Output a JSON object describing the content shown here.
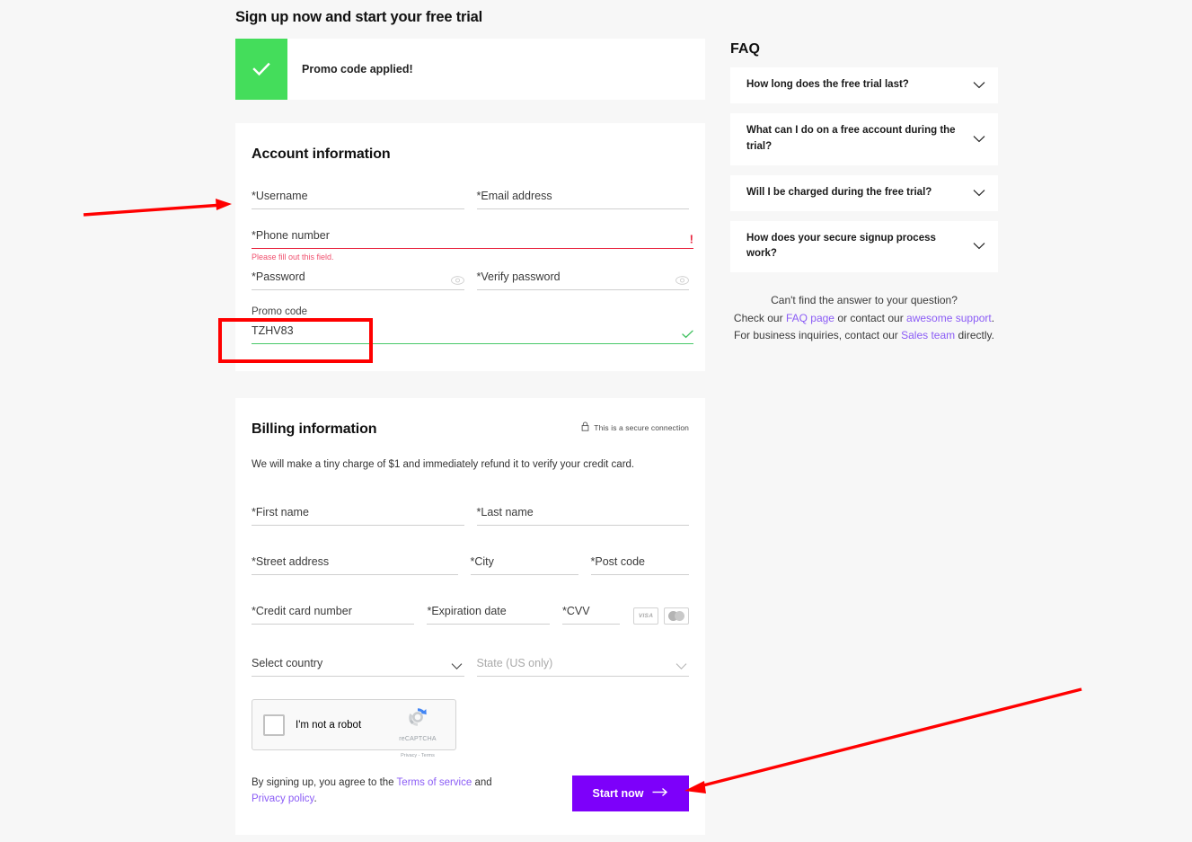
{
  "colors": {
    "background": "#f7f7f7",
    "card": "#ffffff",
    "accent_purple": "#7d00fa",
    "link_purple": "#8b5cf6",
    "success_green": "#44dd5b",
    "error_red": "#e8253f",
    "annotation_red": "#ff0000"
  },
  "page": {
    "title": "Sign up now and start your free trial"
  },
  "promo_banner": {
    "icon": "check-icon",
    "message": "Promo code applied!"
  },
  "account": {
    "title": "Account information",
    "fields": {
      "username": {
        "label": "*Username",
        "value": ""
      },
      "email": {
        "label": "*Email address",
        "value": ""
      },
      "phone": {
        "label": "*Phone number",
        "value": "",
        "state": "error",
        "error_icon": "!",
        "error_message": "Please fill out this field."
      },
      "password": {
        "label": "*Password",
        "value": "",
        "toggle_icon": "eye-icon"
      },
      "verify_password": {
        "label": "*Verify password",
        "value": "",
        "toggle_icon": "eye-icon"
      },
      "promo_code": {
        "label": "Promo code",
        "value": "TZHV83",
        "state": "valid",
        "valid_icon": "check-icon"
      }
    }
  },
  "billing": {
    "title": "Billing information",
    "secure_note": "This is a secure connection",
    "secure_icon": "lock-icon",
    "subtitle": "We will make a tiny charge of $1 and immediately refund it to verify your credit card.",
    "fields": {
      "first_name": {
        "label": "*First name",
        "value": ""
      },
      "last_name": {
        "label": "*Last name",
        "value": ""
      },
      "street": {
        "label": "*Street address",
        "value": ""
      },
      "city": {
        "label": "*City",
        "value": ""
      },
      "post_code": {
        "label": "*Post code",
        "value": ""
      },
      "card_number": {
        "label": "*Credit card number",
        "value": ""
      },
      "expiration": {
        "label": "*Expiration date",
        "value": ""
      },
      "cvv": {
        "label": "*CVV",
        "value": ""
      },
      "country": {
        "label": "Select country",
        "value": "",
        "icon": "chevron-down-icon"
      },
      "state": {
        "label": "State (US only)",
        "value": "",
        "icon": "chevron-down-icon"
      }
    },
    "card_brands": [
      {
        "name": "visa-card-icon",
        "label": "VISA"
      },
      {
        "name": "mastercard-card-icon",
        "label": ""
      }
    ],
    "recaptcha": {
      "checkbox_label": "I'm not a robot",
      "brand": "reCAPTCHA",
      "links": "Privacy - Terms"
    },
    "terms": {
      "prefix": "By signing up, you agree to the ",
      "terms_link": "Terms of service",
      "middle": " and ",
      "privacy_link": "Privacy policy",
      "suffix": "."
    },
    "submit": {
      "label": "Start now",
      "icon": "arrow-right-icon"
    }
  },
  "faq": {
    "title": "FAQ",
    "items": [
      {
        "question": "How long does the free trial last?",
        "icon": "chevron-down-icon"
      },
      {
        "question": "What can I do on a free account during the trial?",
        "icon": "chevron-down-icon"
      },
      {
        "question": "Will I be charged during the free trial?",
        "icon": "chevron-down-icon"
      },
      {
        "question": "How does your secure signup process work?",
        "icon": "chevron-down-icon"
      }
    ],
    "footer": {
      "line1": "Can't find the answer to your question?",
      "line2_prefix": "Check our ",
      "line2_link1": "FAQ page",
      "line2_middle": " or contact our ",
      "line2_link2": "awesome support",
      "line2_suffix": ".",
      "line3_prefix": "For business inquiries, contact our ",
      "line3_link": "Sales team",
      "line3_suffix": " directly."
    }
  },
  "annotations": {
    "arrow_to_username": "red-arrow-pointing-right-at-username-field",
    "arrow_to_start_now": "red-arrow-pointing-left-at-start-now-button",
    "promo_code_highlight": "red-rectangle-around-promo-code-field"
  }
}
